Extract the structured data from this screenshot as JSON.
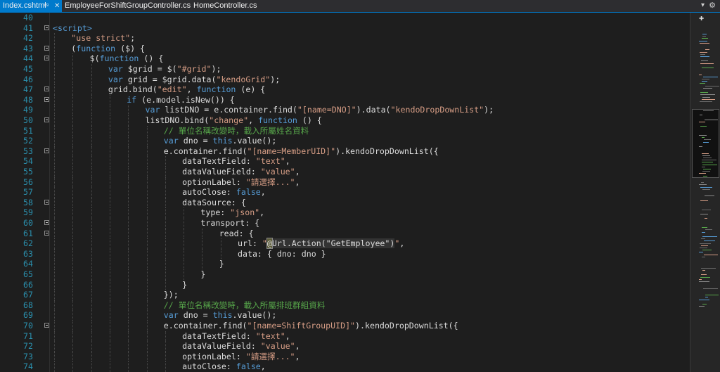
{
  "tabs": [
    {
      "label": "Index.cshtml",
      "active": true
    },
    {
      "label": "EmployeeForShiftGroupController.cs",
      "active": false
    },
    {
      "label": "HomeController.cs",
      "active": false
    }
  ],
  "tab_icons": {
    "pin": "pin-icon",
    "close": "close-icon",
    "dropdown": "chevron-down-icon",
    "settings": "gear-icon"
  },
  "colors": {
    "background": "#1e1e1e",
    "line_number": "#2b91af",
    "keyword": "#569cd6",
    "string": "#d69d85",
    "comment": "#57a64a",
    "text": "#dcdcdc",
    "accent": "#007acc"
  },
  "code_lines": [
    {
      "num": "40",
      "fold": false,
      "indent": 0,
      "tokens": []
    },
    {
      "num": "41",
      "fold": true,
      "indent": 0,
      "tokens": [
        {
          "t": "tag",
          "v": "<script>"
        }
      ]
    },
    {
      "num": "42",
      "fold": false,
      "indent": 1,
      "tokens": [
        {
          "t": "str",
          "v": "\"use strict\""
        },
        {
          "t": "p",
          "v": ";"
        }
      ]
    },
    {
      "num": "43",
      "fold": true,
      "indent": 1,
      "tokens": [
        {
          "t": "p",
          "v": "("
        },
        {
          "t": "kw",
          "v": "function"
        },
        {
          "t": "p",
          "v": " ($) {"
        }
      ]
    },
    {
      "num": "44",
      "fold": true,
      "indent": 2,
      "tokens": [
        {
          "t": "p",
          "v": "$("
        },
        {
          "t": "kw",
          "v": "function"
        },
        {
          "t": "p",
          "v": " () {"
        }
      ]
    },
    {
      "num": "45",
      "fold": false,
      "indent": 3,
      "tokens": [
        {
          "t": "kw",
          "v": "var"
        },
        {
          "t": "p",
          "v": " $grid = $("
        },
        {
          "t": "str",
          "v": "\"#grid\""
        },
        {
          "t": "p",
          "v": ");"
        }
      ]
    },
    {
      "num": "46",
      "fold": false,
      "indent": 3,
      "tokens": [
        {
          "t": "kw",
          "v": "var"
        },
        {
          "t": "p",
          "v": " grid = $grid.data("
        },
        {
          "t": "str",
          "v": "\"kendoGrid\""
        },
        {
          "t": "p",
          "v": ");"
        }
      ]
    },
    {
      "num": "47",
      "fold": true,
      "indent": 3,
      "tokens": [
        {
          "t": "p",
          "v": "grid.bind("
        },
        {
          "t": "str",
          "v": "\"edit\""
        },
        {
          "t": "p",
          "v": ", "
        },
        {
          "t": "kw",
          "v": "function"
        },
        {
          "t": "p",
          "v": " (e) {"
        }
      ]
    },
    {
      "num": "48",
      "fold": true,
      "indent": 4,
      "tokens": [
        {
          "t": "kw",
          "v": "if"
        },
        {
          "t": "p",
          "v": " (e.model.isNew()) {"
        }
      ]
    },
    {
      "num": "49",
      "fold": false,
      "indent": 5,
      "tokens": [
        {
          "t": "kw",
          "v": "var"
        },
        {
          "t": "p",
          "v": " listDNO = e.container.find("
        },
        {
          "t": "str",
          "v": "\"[name=DNO]\""
        },
        {
          "t": "p",
          "v": ").data("
        },
        {
          "t": "str",
          "v": "\"kendoDropDownList\""
        },
        {
          "t": "p",
          "v": ");"
        }
      ]
    },
    {
      "num": "50",
      "fold": true,
      "indent": 5,
      "tokens": [
        {
          "t": "p",
          "v": "listDNO.bind("
        },
        {
          "t": "str",
          "v": "\"change\""
        },
        {
          "t": "p",
          "v": ", "
        },
        {
          "t": "kw",
          "v": "function"
        },
        {
          "t": "p",
          "v": " () {"
        }
      ]
    },
    {
      "num": "51",
      "fold": false,
      "indent": 6,
      "tokens": [
        {
          "t": "com",
          "v": "// 單位名稱改變時，載入所屬姓名資料"
        }
      ]
    },
    {
      "num": "52",
      "fold": false,
      "indent": 6,
      "tokens": [
        {
          "t": "kw",
          "v": "var"
        },
        {
          "t": "p",
          "v": " dno = "
        },
        {
          "t": "kw",
          "v": "this"
        },
        {
          "t": "p",
          "v": ".value();"
        }
      ]
    },
    {
      "num": "53",
      "fold": true,
      "indent": 6,
      "tokens": [
        {
          "t": "p",
          "v": "e.container.find("
        },
        {
          "t": "str",
          "v": "\"[name=MemberUID]\""
        },
        {
          "t": "p",
          "v": ").kendoDropDownList({"
        }
      ]
    },
    {
      "num": "54",
      "fold": false,
      "indent": 7,
      "tokens": [
        {
          "t": "p",
          "v": "dataTextField: "
        },
        {
          "t": "str",
          "v": "\"text\""
        },
        {
          "t": "p",
          "v": ","
        }
      ]
    },
    {
      "num": "55",
      "fold": false,
      "indent": 7,
      "tokens": [
        {
          "t": "p",
          "v": "dataValueField: "
        },
        {
          "t": "str",
          "v": "\"value\""
        },
        {
          "t": "p",
          "v": ","
        }
      ]
    },
    {
      "num": "56",
      "fold": false,
      "indent": 7,
      "tokens": [
        {
          "t": "p",
          "v": "optionLabel: "
        },
        {
          "t": "str",
          "v": "\"請選擇...\""
        },
        {
          "t": "p",
          "v": ","
        }
      ]
    },
    {
      "num": "57",
      "fold": false,
      "indent": 7,
      "tokens": [
        {
          "t": "p",
          "v": "autoClose: "
        },
        {
          "t": "kw",
          "v": "false"
        },
        {
          "t": "p",
          "v": ","
        }
      ]
    },
    {
      "num": "58",
      "fold": true,
      "indent": 7,
      "tokens": [
        {
          "t": "p",
          "v": "dataSource: {"
        }
      ]
    },
    {
      "num": "59",
      "fold": false,
      "indent": 8,
      "tokens": [
        {
          "t": "p",
          "v": "type: "
        },
        {
          "t": "str",
          "v": "\"json\""
        },
        {
          "t": "p",
          "v": ","
        }
      ]
    },
    {
      "num": "60",
      "fold": true,
      "indent": 8,
      "tokens": [
        {
          "t": "p",
          "v": "transport: {"
        }
      ]
    },
    {
      "num": "61",
      "fold": true,
      "indent": 9,
      "tokens": [
        {
          "t": "p",
          "v": "read: {"
        }
      ]
    },
    {
      "num": "62",
      "fold": false,
      "indent": 10,
      "tokens": [
        {
          "t": "p",
          "v": "url: "
        },
        {
          "t": "str",
          "v": "\""
        },
        {
          "t": "at",
          "v": "@"
        },
        {
          "t": "razor",
          "v": "Url.Action("
        },
        {
          "t": "rstr",
          "v": "\"GetEmployee\""
        },
        {
          "t": "razor",
          "v": ")"
        },
        {
          "t": "str",
          "v": "\""
        },
        {
          "t": "p",
          "v": ","
        }
      ]
    },
    {
      "num": "63",
      "fold": false,
      "indent": 10,
      "tokens": [
        {
          "t": "p",
          "v": "data: { dno: dno }"
        }
      ]
    },
    {
      "num": "64",
      "fold": false,
      "indent": 9,
      "tokens": [
        {
          "t": "p",
          "v": "}"
        }
      ]
    },
    {
      "num": "65",
      "fold": false,
      "indent": 8,
      "tokens": [
        {
          "t": "p",
          "v": "}"
        }
      ]
    },
    {
      "num": "66",
      "fold": false,
      "indent": 7,
      "tokens": [
        {
          "t": "p",
          "v": "}"
        }
      ]
    },
    {
      "num": "67",
      "fold": false,
      "indent": 6,
      "tokens": [
        {
          "t": "p",
          "v": "});"
        }
      ]
    },
    {
      "num": "68",
      "fold": false,
      "indent": 6,
      "tokens": [
        {
          "t": "com",
          "v": "// 單位名稱改變時，載入所屬排班群組資料"
        }
      ]
    },
    {
      "num": "69",
      "fold": false,
      "indent": 6,
      "tokens": [
        {
          "t": "kw",
          "v": "var"
        },
        {
          "t": "p",
          "v": " dno = "
        },
        {
          "t": "kw",
          "v": "this"
        },
        {
          "t": "p",
          "v": ".value();"
        }
      ]
    },
    {
      "num": "70",
      "fold": true,
      "indent": 6,
      "tokens": [
        {
          "t": "p",
          "v": "e.container.find("
        },
        {
          "t": "str",
          "v": "\"[name=ShiftGroupUID]\""
        },
        {
          "t": "p",
          "v": ").kendoDropDownList({"
        }
      ]
    },
    {
      "num": "71",
      "fold": false,
      "indent": 7,
      "tokens": [
        {
          "t": "p",
          "v": "dataTextField: "
        },
        {
          "t": "str",
          "v": "\"text\""
        },
        {
          "t": "p",
          "v": ","
        }
      ]
    },
    {
      "num": "72",
      "fold": false,
      "indent": 7,
      "tokens": [
        {
          "t": "p",
          "v": "dataValueField: "
        },
        {
          "t": "str",
          "v": "\"value\""
        },
        {
          "t": "p",
          "v": ","
        }
      ]
    },
    {
      "num": "73",
      "fold": false,
      "indent": 7,
      "tokens": [
        {
          "t": "p",
          "v": "optionLabel: "
        },
        {
          "t": "str",
          "v": "\"請選擇...\""
        },
        {
          "t": "p",
          "v": ","
        }
      ]
    },
    {
      "num": "74",
      "fold": false,
      "indent": 7,
      "tokens": [
        {
          "t": "p",
          "v": "autoClose: "
        },
        {
          "t": "kw",
          "v": "false"
        },
        {
          "t": "p",
          "v": ","
        }
      ]
    }
  ]
}
